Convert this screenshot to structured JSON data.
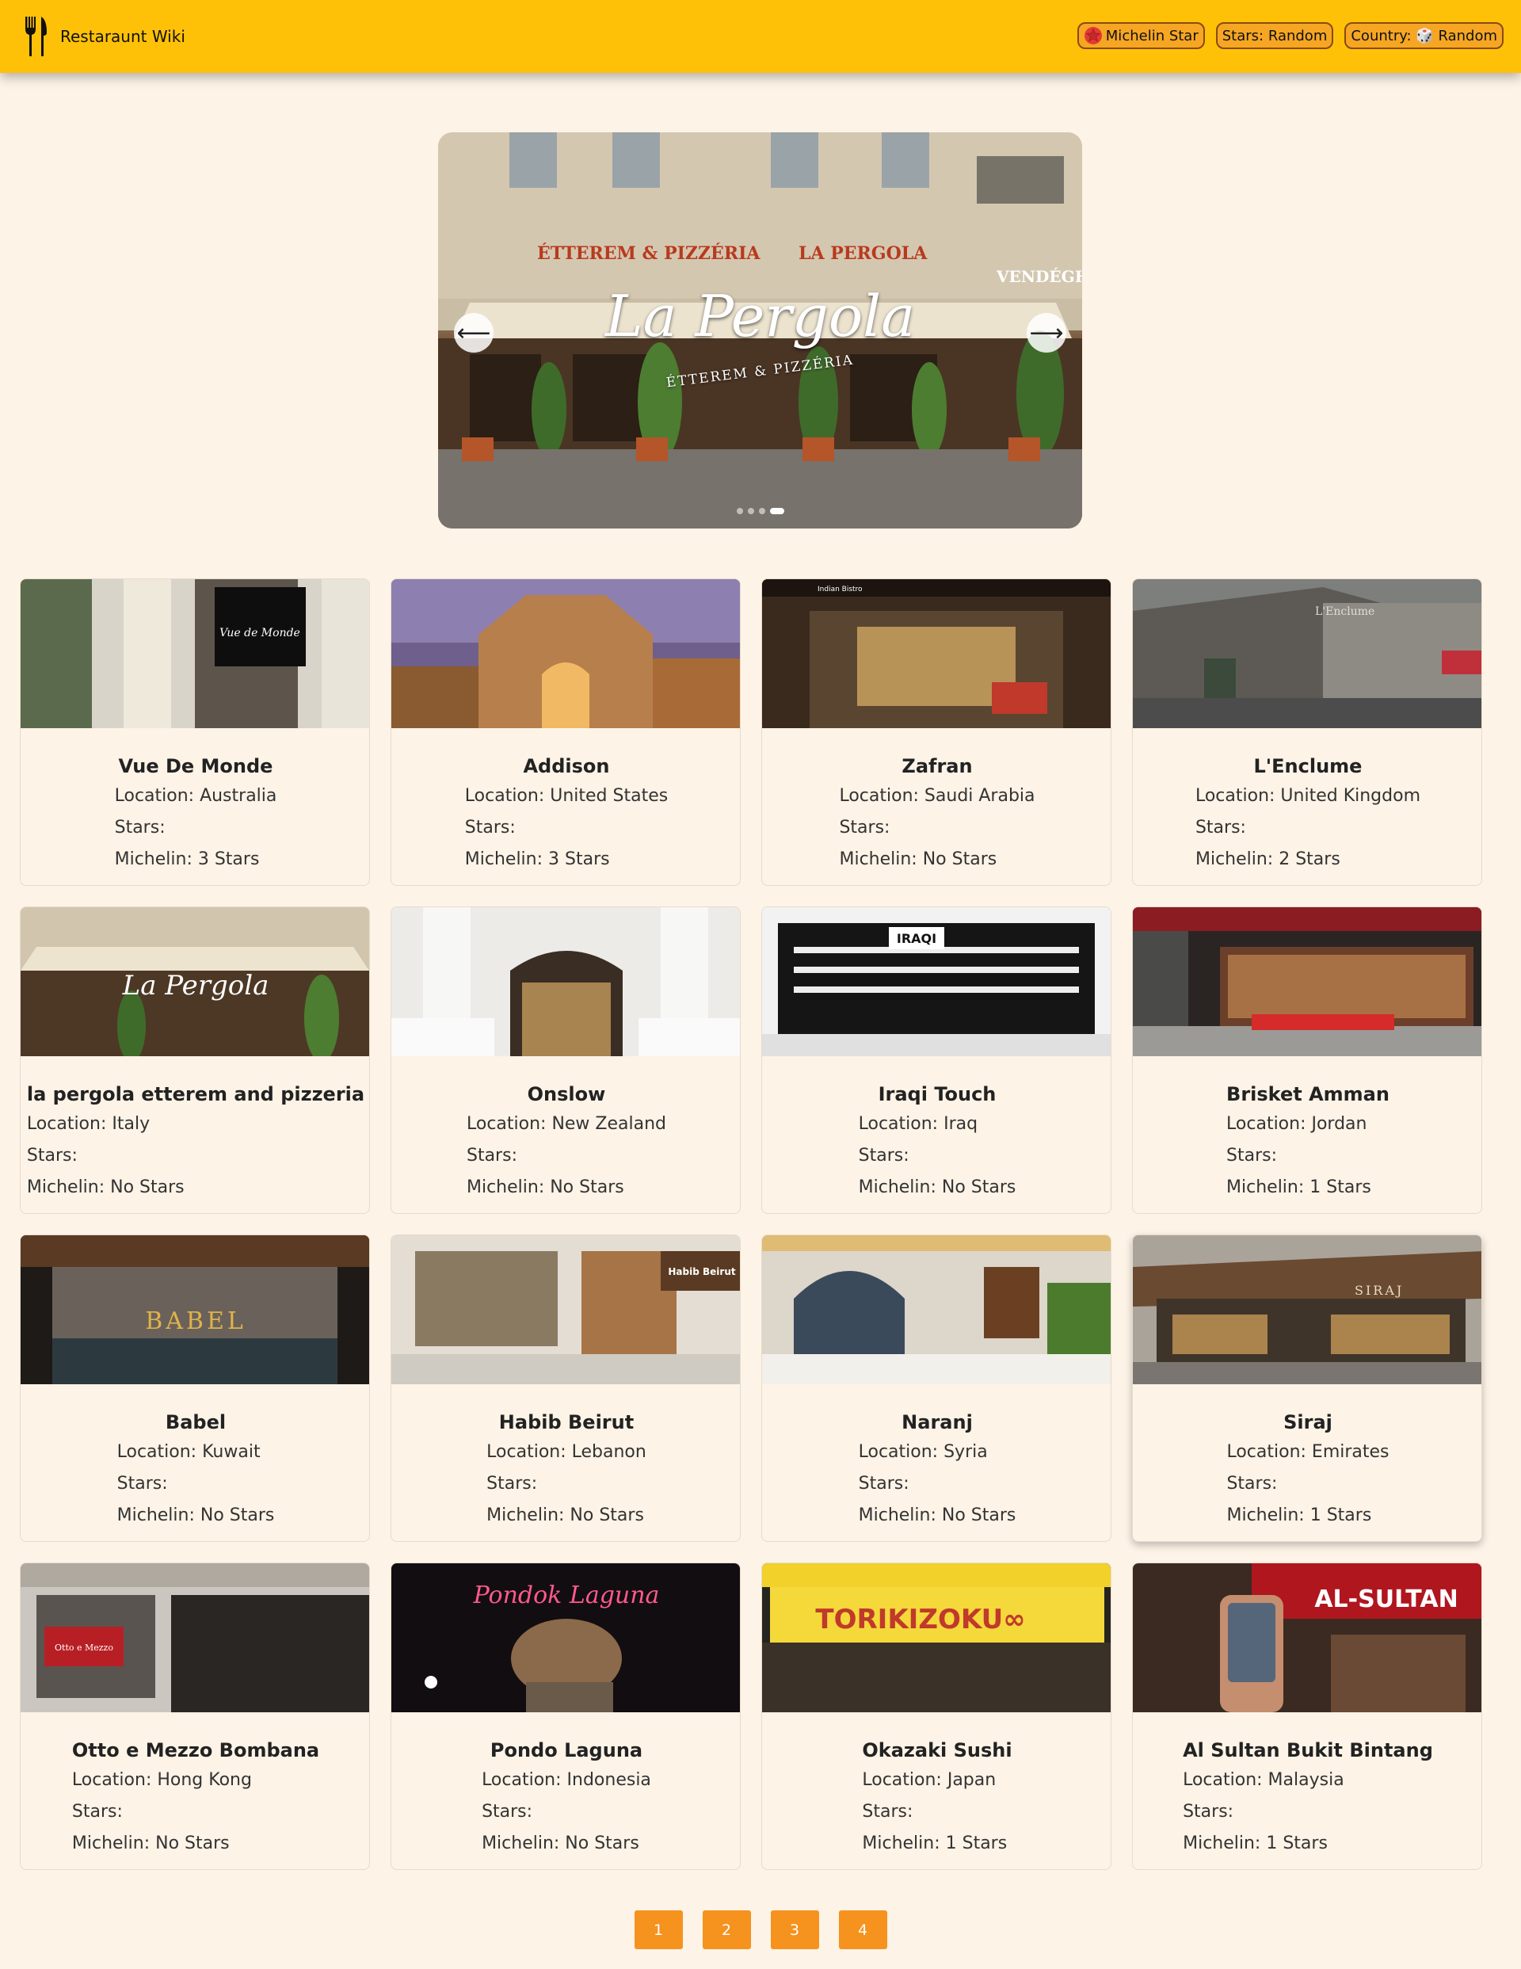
{
  "navbar": {
    "brand": "Restaraunt Wiki",
    "brand_icon": "fork-knife-icon",
    "buttons": [
      {
        "label": "Michelin Star",
        "icon": "star-icon"
      },
      {
        "label": "Stars: Random"
      },
      {
        "label": "Country: 🎲 Random"
      }
    ]
  },
  "carousel": {
    "title": "La Pergola",
    "subtitle": "ÉTTEREM & PIZZÉRIA",
    "sign_left": "ÉTTEREM & PIZZÉRIA",
    "sign_right": "LA PERGOLA",
    "sign_corner": "VENDÉGHÁZ",
    "prev_arrow": "⟵",
    "next_arrow": "⟶",
    "slide_count": 4,
    "active_slide": 4
  },
  "restaurants": [
    {
      "name": "Vue De Monde",
      "location": "Location: Australia",
      "stars": "Stars:",
      "michelin": "Michelin: 3 Stars",
      "image_text": "Vue de Monde"
    },
    {
      "name": "Addison",
      "location": "Location: United States",
      "stars": "Stars:",
      "michelin": "Michelin: 3 Stars"
    },
    {
      "name": "Zafran",
      "location": "Location: Saudi Arabia",
      "stars": "Stars:",
      "michelin": "Michelin: No Stars",
      "image_text": "Indian Bistro"
    },
    {
      "name": "L'Enclume",
      "location": "Location: United Kingdom",
      "stars": "Stars:",
      "michelin": "Michelin: 2 Stars",
      "image_text": "L'Enclume"
    },
    {
      "name": "la pergola etterem and pizzeria",
      "location": "Location: Italy",
      "stars": "Stars:",
      "michelin": "Michelin: No Stars",
      "image_text": "La Pergola"
    },
    {
      "name": "Onslow",
      "location": "Location: New Zealand",
      "stars": "Stars:",
      "michelin": "Michelin: No Stars"
    },
    {
      "name": "Iraqi Touch",
      "location": "Location: Iraq",
      "stars": "Stars:",
      "michelin": "Michelin: No Stars",
      "image_text": "IRAQI"
    },
    {
      "name": "Brisket Amman",
      "location": "Location: Jordan",
      "stars": "Stars:",
      "michelin": "Michelin: 1 Stars"
    },
    {
      "name": "Babel",
      "location": "Location: Kuwait",
      "stars": "Stars:",
      "michelin": "Michelin: No Stars",
      "image_text": "BABEL"
    },
    {
      "name": "Habib Beirut",
      "location": "Location: Lebanon",
      "stars": "Stars:",
      "michelin": "Michelin: No Stars",
      "image_text": "Habib Beirut"
    },
    {
      "name": "Naranj",
      "location": "Location: Syria",
      "stars": "Stars:",
      "michelin": "Michelin: No Stars"
    },
    {
      "name": "Siraj",
      "location": "Location: Emirates",
      "stars": "Stars:",
      "michelin": "Michelin: 1 Stars",
      "image_text": "SIRAJ"
    },
    {
      "name": "Otto e Mezzo Bombana",
      "location": "Location: Hong Kong",
      "stars": "Stars:",
      "michelin": "Michelin: No Stars",
      "image_text": "Otto e Mezzo"
    },
    {
      "name": "Pondo Laguna",
      "location": "Location: Indonesia",
      "stars": "Stars:",
      "michelin": "Michelin: No Stars",
      "image_text": "Pondok Laguna"
    },
    {
      "name": "Okazaki Sushi",
      "location": "Location: Japan",
      "stars": "Stars:",
      "michelin": "Michelin: 1 Stars",
      "image_text": "TORIKIZOKU∞"
    },
    {
      "name": "Al Sultan Bukit Bintang",
      "location": "Location: Malaysia",
      "stars": "Stars:",
      "michelin": "Michelin: 1 Stars",
      "image_text": "AL-SULTAN"
    }
  ],
  "pagination": [
    "1",
    "2",
    "3",
    "4"
  ],
  "colors": {
    "navbar": "#ffc107",
    "button": "#f6a623",
    "page_button": "#f6921e",
    "background": "#fdf3e7",
    "star": "#e53935"
  }
}
